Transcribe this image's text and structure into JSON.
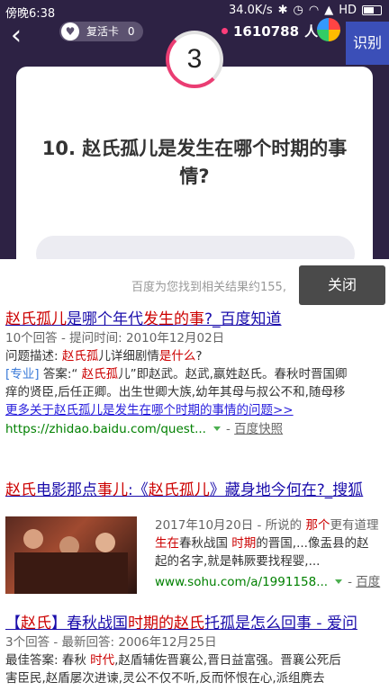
{
  "status_bar": {
    "time": "傍晚6:38",
    "speed": "34.0K/s",
    "hd": "HD"
  },
  "quiz": {
    "back_label": "‹",
    "revive_card_label": "复活卡",
    "revive_card_count": "0",
    "viewer_count": "1610788",
    "viewer_unit": "人",
    "scan_button_label": "识别",
    "timer_value": "3",
    "question_line1": "10. 赵氏孤儿是发生在哪个时期的事",
    "question_line2": "情?"
  },
  "search": {
    "summary": "百度为您找到相关结果约155,",
    "close_label": "关闭",
    "results": [
      {
        "title_a": "赵氏孤儿",
        "title_b": "是哪个年代",
        "title_c": "发生的事",
        "title_d": "?_百度知道",
        "meta": "10个回答 - 提问时间: 2010年12月02日",
        "desc_label": "问题描述: ",
        "desc_hl": "赵氏孤",
        "desc_mid": "儿详细剧情",
        "desc_hl2": "是什么",
        "desc_end": "?",
        "tag": "[专业]",
        "ans_a": " 答案:“ ",
        "ans_hl": "赵氏孤",
        "ans_b": "儿”即赵武。赵武,嬴姓赵氏。春秋时晋国卿",
        "line2": "痒的贤臣,后任正卿。出生世卿大族,幼年其母与叔公不和,随母移",
        "more": "更多关于赵氏孤儿是发生在哪个时期的事情的问题>>",
        "url": "https://zhidao.baidu.com/quest...",
        "snapshot": "百度快照"
      },
      {
        "title_a": "赵氏",
        "title_b": "电影那点",
        "title_c": "事儿",
        "title_d": ":《",
        "title_e": "赵氏孤儿",
        "title_f": "》藏身地今何在?_搜狐",
        "date_line": "2017年10月20日 - 所说的 ",
        "date_hl": "那个",
        "date_end": "更有道理",
        "l2_hl": "生在",
        "l2_mid": "春秋战国 ",
        "l2_hl2": "时期",
        "l2_end": "的晋国,...像盂县的赵",
        "l3": "起的名字,就是韩厥要找程婴,...",
        "url": "www.sohu.com/a/1991158...",
        "snapshot": "百度"
      },
      {
        "title_a": "【",
        "title_b": "赵氏",
        "title_c": "】春秋战国",
        "title_d": "时期的赵氏",
        "title_e": "托孤是怎么回事 - 爱问",
        "meta": "3个回答 - 最新回答: 2006年12月25日",
        "ans_a": "最佳答案: 春秋 ",
        "ans_hl": "时代",
        "ans_b": ",赵盾辅佐晋襄公,晋日益富强。晋襄公死后",
        "line2": "害臣民,赵盾屡次进谏,灵公不仅不听,反而怀恨在心,派组麂去"
      }
    ]
  }
}
